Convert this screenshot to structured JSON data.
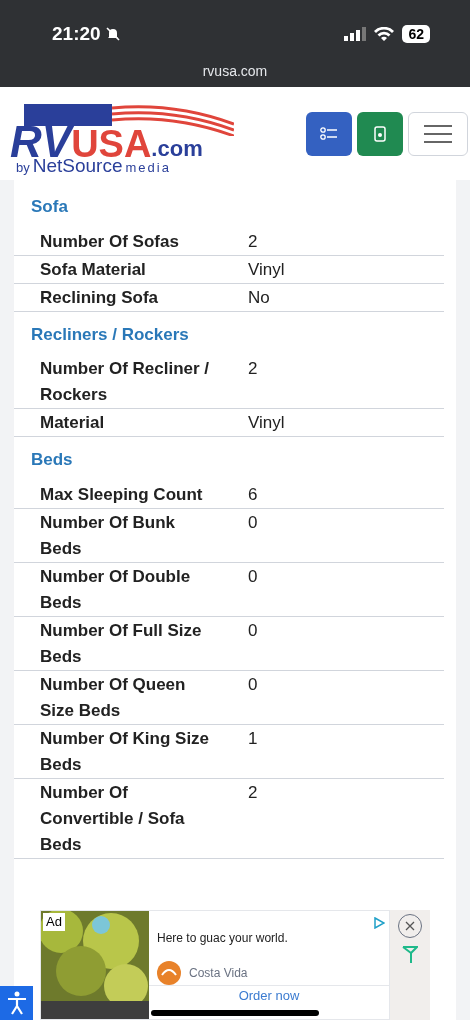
{
  "status_bar": {
    "time": "21:20",
    "battery": "62"
  },
  "url_bar": {
    "address": "rvusa.com"
  },
  "logo": {
    "brand": "RV",
    "brand_accent": "USA",
    ".com": ".com",
    "by": "by",
    "source": "NetSource",
    "media": "media"
  },
  "sections": [
    {
      "title": "Sofa",
      "rows": [
        {
          "label": "Number Of Sofas",
          "value": "2"
        },
        {
          "label": "Sofa Material",
          "value": "Vinyl"
        },
        {
          "label": "Reclining Sofa",
          "value": "No"
        }
      ]
    },
    {
      "title": "Recliners / Rockers",
      "rows": [
        {
          "label": "Number Of Recliner / Rockers",
          "value": "2"
        },
        {
          "label": "Material",
          "value": "Vinyl"
        }
      ]
    },
    {
      "title": "Beds",
      "rows": [
        {
          "label": "Max Sleeping Count",
          "value": "6"
        },
        {
          "label": "Number Of Bunk Beds",
          "value": "0"
        },
        {
          "label": "Number Of Double Beds",
          "value": "0"
        },
        {
          "label": "Number Of Full Size Beds",
          "value": "0"
        },
        {
          "label": "Number Of Queen Size Beds",
          "value": "0"
        },
        {
          "label": "Number Of King Size Beds",
          "value": "1"
        },
        {
          "label": "Number Of Convertible / Sofa Beds",
          "value": "2"
        }
      ]
    }
  ],
  "ad": {
    "badge": "Ad",
    "headline": "Here to guac your world.",
    "advertiser": "Costa Vida",
    "cta": "Order now"
  }
}
